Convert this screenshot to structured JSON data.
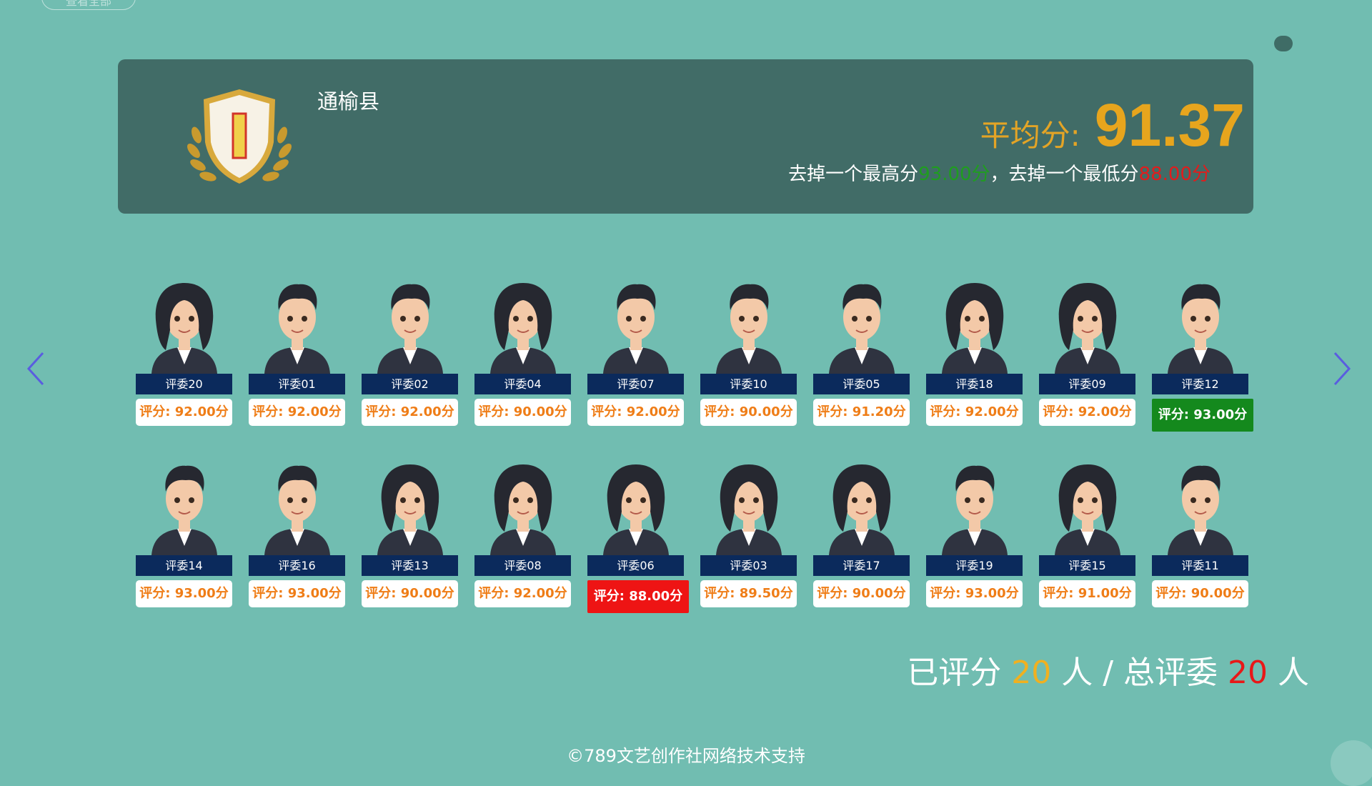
{
  "header": {
    "view_all_label": "查看全部"
  },
  "banner": {
    "county": "通榆县",
    "avg_label": "平均分:",
    "avg_value": "91.37",
    "drop_prefix": "去掉一个最高分",
    "drop_high": "93.00分",
    "drop_mid": "，去掉一个最低分",
    "drop_low": "88.00分"
  },
  "judges": [
    {
      "name": "评委20",
      "score": "评分: 92.00分",
      "gender": "f",
      "state": "normal"
    },
    {
      "name": "评委01",
      "score": "评分: 92.00分",
      "gender": "m",
      "state": "normal"
    },
    {
      "name": "评委02",
      "score": "评分: 92.00分",
      "gender": "m",
      "state": "normal"
    },
    {
      "name": "评委04",
      "score": "评分: 90.00分",
      "gender": "f",
      "state": "normal"
    },
    {
      "name": "评委07",
      "score": "评分: 92.00分",
      "gender": "m",
      "state": "normal"
    },
    {
      "name": "评委10",
      "score": "评分: 90.00分",
      "gender": "m",
      "state": "normal"
    },
    {
      "name": "评委05",
      "score": "评分: 91.20分",
      "gender": "m",
      "state": "normal"
    },
    {
      "name": "评委18",
      "score": "评分: 92.00分",
      "gender": "f",
      "state": "normal"
    },
    {
      "name": "评委09",
      "score": "评分: 92.00分",
      "gender": "f",
      "state": "normal"
    },
    {
      "name": "评委12",
      "score": "评分: 93.00分",
      "gender": "m",
      "state": "max"
    },
    {
      "name": "评委14",
      "score": "评分: 93.00分",
      "gender": "m",
      "state": "normal"
    },
    {
      "name": "评委16",
      "score": "评分: 93.00分",
      "gender": "m",
      "state": "normal"
    },
    {
      "name": "评委13",
      "score": "评分: 90.00分",
      "gender": "f",
      "state": "normal"
    },
    {
      "name": "评委08",
      "score": "评分: 92.00分",
      "gender": "f",
      "state": "normal"
    },
    {
      "name": "评委06",
      "score": "评分: 88.00分",
      "gender": "f",
      "state": "min"
    },
    {
      "name": "评委03",
      "score": "评分: 89.50分",
      "gender": "f",
      "state": "normal"
    },
    {
      "name": "评委17",
      "score": "评分: 90.00分",
      "gender": "f",
      "state": "normal"
    },
    {
      "name": "评委19",
      "score": "评分: 93.00分",
      "gender": "m",
      "state": "normal"
    },
    {
      "name": "评委15",
      "score": "评分: 91.00分",
      "gender": "f",
      "state": "normal"
    },
    {
      "name": "评委11",
      "score": "评分: 90.00分",
      "gender": "m",
      "state": "normal"
    }
  ],
  "count": {
    "prefix": "已评分",
    "done": "20",
    "mid": "人 / 总评委",
    "total": "20",
    "suffix": "人"
  },
  "footer": "©789文艺创作社网络技术支持",
  "icons": [
    "shield-badge-icon",
    "chevron-left-icon",
    "chevron-right-icon",
    "back-to-top-icon"
  ],
  "colors": {
    "background": "#71bdb1",
    "banner": "#416c67",
    "accent": "#e7a51d",
    "high": "#14891d",
    "low": "#ee1414",
    "name_bar": "#0b2a5c"
  }
}
